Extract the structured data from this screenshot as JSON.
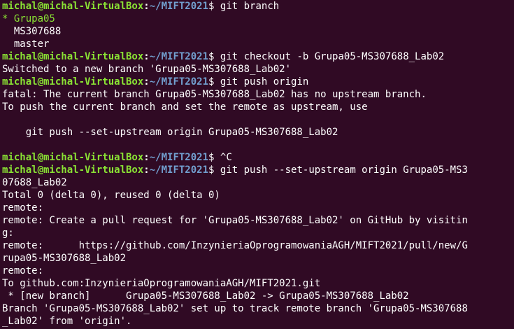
{
  "prompt": {
    "user_host": "michal@michal-VirtualBox",
    "separator": ":",
    "path": "~/MIFT2021",
    "symbol": "$"
  },
  "lines": [
    {
      "type": "prompt",
      "cmd": " git branch"
    },
    {
      "type": "current",
      "text": "* Grupa05"
    },
    {
      "type": "out",
      "text": "  MS307688"
    },
    {
      "type": "out",
      "text": "  master"
    },
    {
      "type": "prompt",
      "cmd": " git checkout -b Grupa05-MS307688_Lab02"
    },
    {
      "type": "out",
      "text": "Switched to a new branch 'Grupa05-MS307688_Lab02'"
    },
    {
      "type": "prompt",
      "cmd": " git push origin"
    },
    {
      "type": "out",
      "text": "fatal: The current branch Grupa05-MS307688_Lab02 has no upstream branch."
    },
    {
      "type": "out",
      "text": "To push the current branch and set the remote as upstream, use"
    },
    {
      "type": "out",
      "text": ""
    },
    {
      "type": "out",
      "text": "    git push --set-upstream origin Grupa05-MS307688_Lab02"
    },
    {
      "type": "out",
      "text": ""
    },
    {
      "type": "prompt",
      "cmd": " ^C"
    },
    {
      "type": "prompt",
      "cmd": " git push --set-upstream origin Grupa05-MS3"
    },
    {
      "type": "out",
      "text": "07688_Lab02"
    },
    {
      "type": "out",
      "text": "Total 0 (delta 0), reused 0 (delta 0)"
    },
    {
      "type": "out",
      "text": "remote:"
    },
    {
      "type": "out",
      "text": "remote: Create a pull request for 'Grupa05-MS307688_Lab02' on GitHub by visitin"
    },
    {
      "type": "out",
      "text": "g:"
    },
    {
      "type": "out",
      "text": "remote:      https://github.com/InzynieriaOprogramowaniaAGH/MIFT2021/pull/new/G"
    },
    {
      "type": "out",
      "text": "rupa05-MS307688_Lab02"
    },
    {
      "type": "out",
      "text": "remote:"
    },
    {
      "type": "out",
      "text": "To github.com:InzynieriaOprogramowaniaAGH/MIFT2021.git"
    },
    {
      "type": "out",
      "text": " * [new branch]      Grupa05-MS307688_Lab02 -> Grupa05-MS307688_Lab02"
    },
    {
      "type": "out",
      "text": "Branch 'Grupa05-MS307688_Lab02' set up to track remote branch 'Grupa05-MS307688"
    },
    {
      "type": "out",
      "text": "_Lab02' from 'origin'."
    }
  ]
}
